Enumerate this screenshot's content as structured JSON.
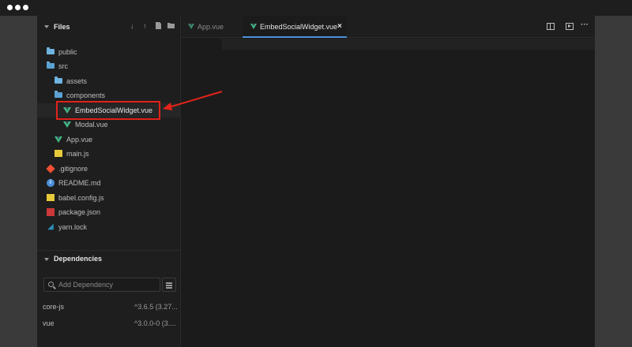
{
  "sidebar": {
    "files_title": "Files",
    "header_icons": [
      "arrow-down-icon",
      "arrow-up-icon",
      "new-file-icon",
      "new-folder-icon"
    ],
    "tree": [
      {
        "label": "public",
        "icon": "folder-icon",
        "depth": 0
      },
      {
        "label": "src",
        "icon": "folder-open-icon",
        "depth": 0
      },
      {
        "label": "assets",
        "icon": "folder-icon",
        "depth": 1
      },
      {
        "label": "components",
        "icon": "folder-open-icon",
        "depth": 1
      },
      {
        "label": "EmbedSocialWidget.vue",
        "icon": "vue-icon",
        "depth": 2,
        "highlighted": true
      },
      {
        "label": "Modal.vue",
        "icon": "vue-icon",
        "depth": 2
      },
      {
        "label": "App.vue",
        "icon": "vue-icon",
        "depth": 1
      },
      {
        "label": "main.js",
        "icon": "js-icon",
        "depth": 1
      },
      {
        "label": ".gitignore",
        "icon": "git-icon",
        "depth": 0
      },
      {
        "label": "README.md",
        "icon": "info-icon",
        "depth": 0
      },
      {
        "label": "babel.config.js",
        "icon": "js-icon",
        "depth": 0
      },
      {
        "label": "package.json",
        "icon": "package-icon",
        "depth": 0
      },
      {
        "label": "yarn.lock",
        "icon": "yarn-icon",
        "depth": 0
      }
    ],
    "dependencies_title": "Dependencies",
    "dependency_input_placeholder": "Add Dependency",
    "dependencies": [
      {
        "name": "core-js",
        "version": "^3.6.5 (3.27..."
      },
      {
        "name": "vue",
        "version": "^3.0.0-0 (3...."
      }
    ]
  },
  "tabs": [
    {
      "label": "App.vue",
      "active": false
    },
    {
      "label": "EmbedSocialWidget.vue",
      "active": true,
      "close": "×"
    }
  ],
  "toolbar": {
    "icons": [
      "split-view-icon",
      "preview-icon",
      "more-icon"
    ],
    "more_glyph": "···"
  },
  "colors": {
    "highlight": "#e2231a",
    "vue_green": "#41b883",
    "active_tab_underline": "#4a90d9"
  }
}
